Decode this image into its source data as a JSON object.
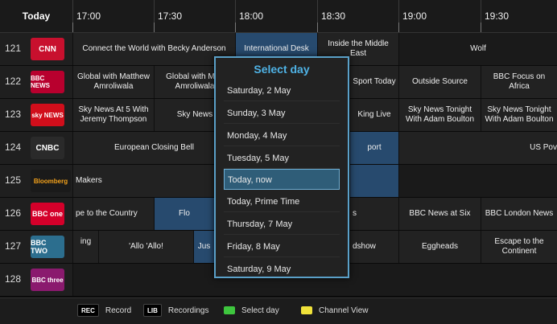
{
  "guide": {
    "today_label": "Today",
    "times": [
      "17:00",
      "17:30",
      "18:00",
      "18:30",
      "19:00",
      "19:30"
    ]
  },
  "channels": [
    {
      "number": "121",
      "logo": "CNN",
      "logo_color": "#c8102e",
      "programs": [
        {
          "title": "Connect the World with Becky Anderson"
        },
        {
          "title": "International Desk"
        },
        {
          "title": "Inside the Middle East"
        },
        {
          "title": "Wolf"
        }
      ]
    },
    {
      "number": "122",
      "logo": "BBC NEWS",
      "logo_color": "#b8002e",
      "programs": [
        {
          "title": "Global with Matthew Amroliwala"
        },
        {
          "title": "Global with Matt Amroliwala"
        },
        {
          "title": "Sport Today"
        },
        {
          "title": "Outside Source"
        },
        {
          "title": "BBC Focus on Africa"
        }
      ]
    },
    {
      "number": "123",
      "logo": "sky NEWS",
      "logo_color": "#d10e1b",
      "programs": [
        {
          "title": "Sky News At 5 With Jeremy Thompson"
        },
        {
          "title": "Sky News"
        },
        {
          "title": "King Live"
        },
        {
          "title": "Sky News Tonight With Adam Boulton"
        },
        {
          "title": "Sky News Tonight With Adam Boulton"
        }
      ]
    },
    {
      "number": "124",
      "logo": "CNBC",
      "logo_color": "#2a2a2a",
      "programs": [
        {
          "title": "European Closing Bell"
        },
        {
          "title": "port"
        },
        {
          "title": "US Pov"
        }
      ]
    },
    {
      "number": "125",
      "logo": "Bloomberg",
      "logo_color": "#1a1a1a",
      "programs": [
        {
          "title": "Makers"
        }
      ]
    },
    {
      "number": "126",
      "logo": "BBC one",
      "logo_color": "#d4002a",
      "programs": [
        {
          "title": "pe to the Country"
        },
        {
          "title": "Flo"
        },
        {
          "title": "s"
        },
        {
          "title": "BBC News at Six"
        },
        {
          "title": "BBC London News"
        }
      ]
    },
    {
      "number": "127",
      "logo": "BBC TWO",
      "logo_color": "#2c6e8e",
      "programs": [
        {
          "title": "ing"
        },
        {
          "title": "'Allo 'Allo!"
        },
        {
          "title": "Jus"
        },
        {
          "title": "dshow"
        },
        {
          "title": "Eggheads"
        },
        {
          "title": "Escape to the Continent"
        }
      ]
    },
    {
      "number": "128",
      "logo": "BBC three",
      "logo_color": "#8a1a6e",
      "programs": []
    }
  ],
  "dialog": {
    "title": "Select day",
    "options": [
      "Saturday, 2 May",
      "Sunday, 3 May",
      "Monday, 4 May",
      "Tuesday, 5 May",
      "Today, now",
      "Today, Prime Time",
      "Thursday, 7 May",
      "Friday, 8 May",
      "Saturday, 9 May"
    ],
    "selected_index": 4
  },
  "footer": {
    "items": [
      {
        "key": "REC",
        "label": "Record"
      },
      {
        "key": "LIB",
        "label": "Recordings"
      },
      {
        "key": "",
        "label": "Select day",
        "color": "#3ec63e"
      },
      {
        "key": "",
        "label": "Channel View",
        "color": "#f0e23a"
      }
    ]
  }
}
